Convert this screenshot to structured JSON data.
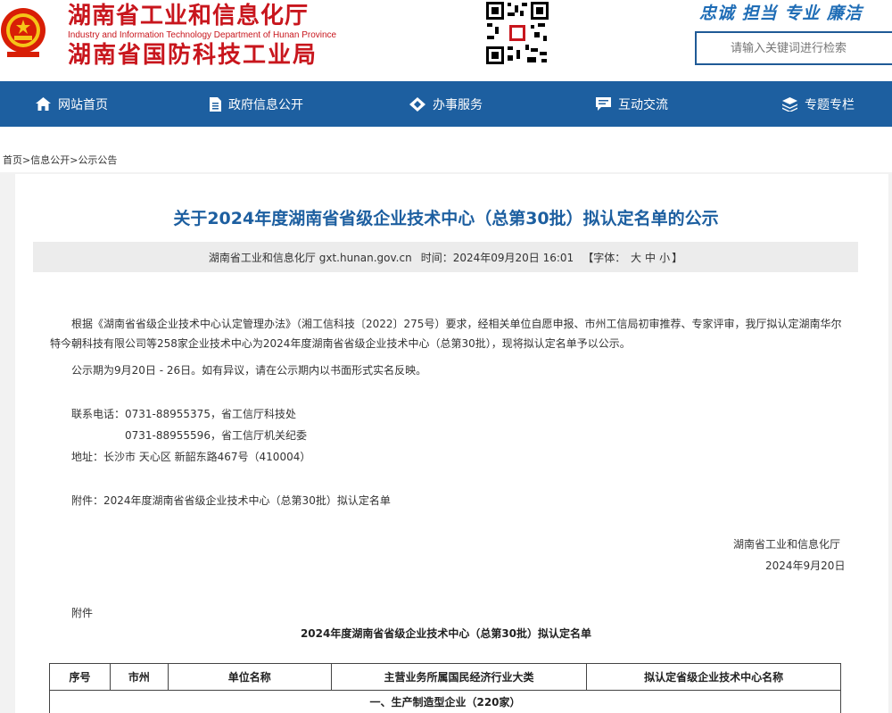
{
  "header": {
    "title_cn_1": "湖南省工业和信息化厅",
    "title_en": "Industry and Information Technology Department of Hunan Province",
    "title_cn_2": "湖南省国防科技工业局",
    "slogan": "忠诚 担当 专业 廉洁",
    "search_placeholder": "请输入关键词进行检索"
  },
  "nav": {
    "items": [
      {
        "label": "网站首页",
        "icon": "home-icon"
      },
      {
        "label": "政府信息公开",
        "icon": "document-icon"
      },
      {
        "label": "办事服务",
        "icon": "diamond-icon"
      },
      {
        "label": "互动交流",
        "icon": "chat-icon"
      },
      {
        "label": "专题专栏",
        "icon": "layers-icon"
      }
    ]
  },
  "breadcrumb": {
    "home": "首页",
    "sep": ">",
    "level1": "信息公开",
    "level2": "公示公告"
  },
  "article": {
    "title": "关于2024年度湖南省省级企业技术中心（总第30批）拟认定名单的公示",
    "source": "湖南省工业和信息化厅 gxt.hunan.gov.cn",
    "time": "时间：2024年09月20日 16:01",
    "font_label": "【字体：",
    "font_large": "大",
    "font_medium": "中",
    "font_small": "小",
    "font_end": "】",
    "para1": "根据《湖南省省级企业技术中心认定管理办法》（湘工信科技〔2022〕275号）要求，经相关单位自愿申报、市州工信局初审推荐、专家评审，我厅拟认定湖南华尔特今朝科技有限公司等258家企业技术中心为2024年度湖南省省级企业技术中心（总第30批），现将拟认定名单予以公示。",
    "para2": "公示期为9月20日 - 26日。如有异议，请在公示期内以书面形式实名反映。",
    "contact1": "联系电话：0731-88955375，省工信厅科技处",
    "contact2": "0731-88955596，省工信厅机关纪委",
    "address": "地址：长沙市 天心区 新韶东路467号（410004）",
    "attachment_label": "附件：",
    "attachment_link": "2024年度湖南省省级企业技术中心（总第30批）拟认定名单",
    "signature_org": "湖南省工业和信息化厅",
    "signature_date": "2024年9月20日",
    "appendix_label": "附件",
    "table_caption": "2024年度湖南省省级企业技术中心（总第30批）拟认定名单"
  },
  "table": {
    "headers": [
      "序号",
      "市州",
      "单位名称",
      "主营业务所属国民经济行业大类",
      "拟认定省级企业技术中心名称"
    ],
    "section_row": "一、生产制造型企业（220家）"
  },
  "colors": {
    "brand_red": "#c8161d",
    "nav_blue": "#1d5fa0",
    "slogan_blue": "#1f6db6"
  }
}
